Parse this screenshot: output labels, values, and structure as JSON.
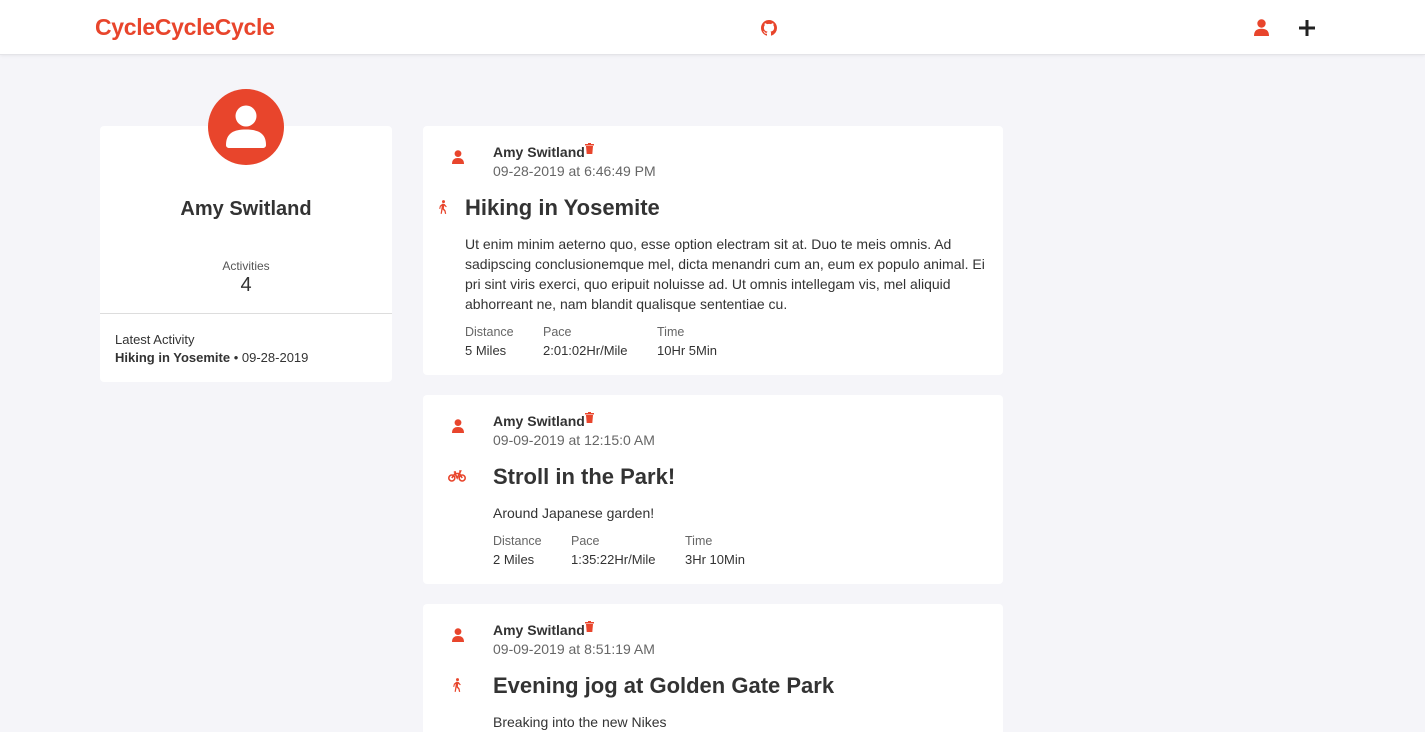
{
  "nav": {
    "brand": "CycleCycleCycle",
    "icons": [
      "github-icon",
      "user-icon",
      "plus-icon"
    ]
  },
  "colors": {
    "accent": "#e8452c",
    "background": "#f5f5f9",
    "card": "#ffffff"
  },
  "profile": {
    "name": "Amy Switland",
    "activities_label": "Activities",
    "activities_count": "4",
    "latest_label": "Latest Activity",
    "latest_title": "Hiking in Yosemite",
    "latest_date": " • 09-28-2019"
  },
  "feed": [
    {
      "author": "Amy Switland",
      "date": "09-28-2019 at 6:46:49 PM",
      "type_icon": "walking-icon",
      "title": "Hiking in Yosemite",
      "description": "Ut enim minim aeterno quo, esse option electram sit at. Duo te meis omnis. Ad sadipscing conclusionemque mel, dicta menandri cum an, eum ex populo animal. Ei pri sint viris exerci, quo eripuit noluisse ad. Ut omnis intellegam vis, mel aliquid abhorreant ne, nam blandit qualisque sententiae cu.",
      "stats": [
        {
          "label": "Distance",
          "value": "5 Miles"
        },
        {
          "label": "Pace",
          "value": "2:01:02Hr/Mile"
        },
        {
          "label": "Time",
          "value": "10Hr 5Min"
        }
      ]
    },
    {
      "author": "Amy Switland",
      "date": "09-09-2019 at 12:15:0 AM",
      "type_icon": "bicycle-icon",
      "title": "Stroll in the Park!",
      "description": "Around Japanese garden!",
      "stats": [
        {
          "label": "Distance",
          "value": "2 Miles"
        },
        {
          "label": "Pace",
          "value": "1:35:22Hr/Mile"
        },
        {
          "label": "Time",
          "value": "3Hr 10Min"
        }
      ]
    },
    {
      "author": "Amy Switland",
      "date": "09-09-2019 at 8:51:19 AM",
      "type_icon": "walking-icon",
      "title": "Evening jog at Golden Gate Park",
      "description": "Breaking into the new Nikes"
    }
  ]
}
